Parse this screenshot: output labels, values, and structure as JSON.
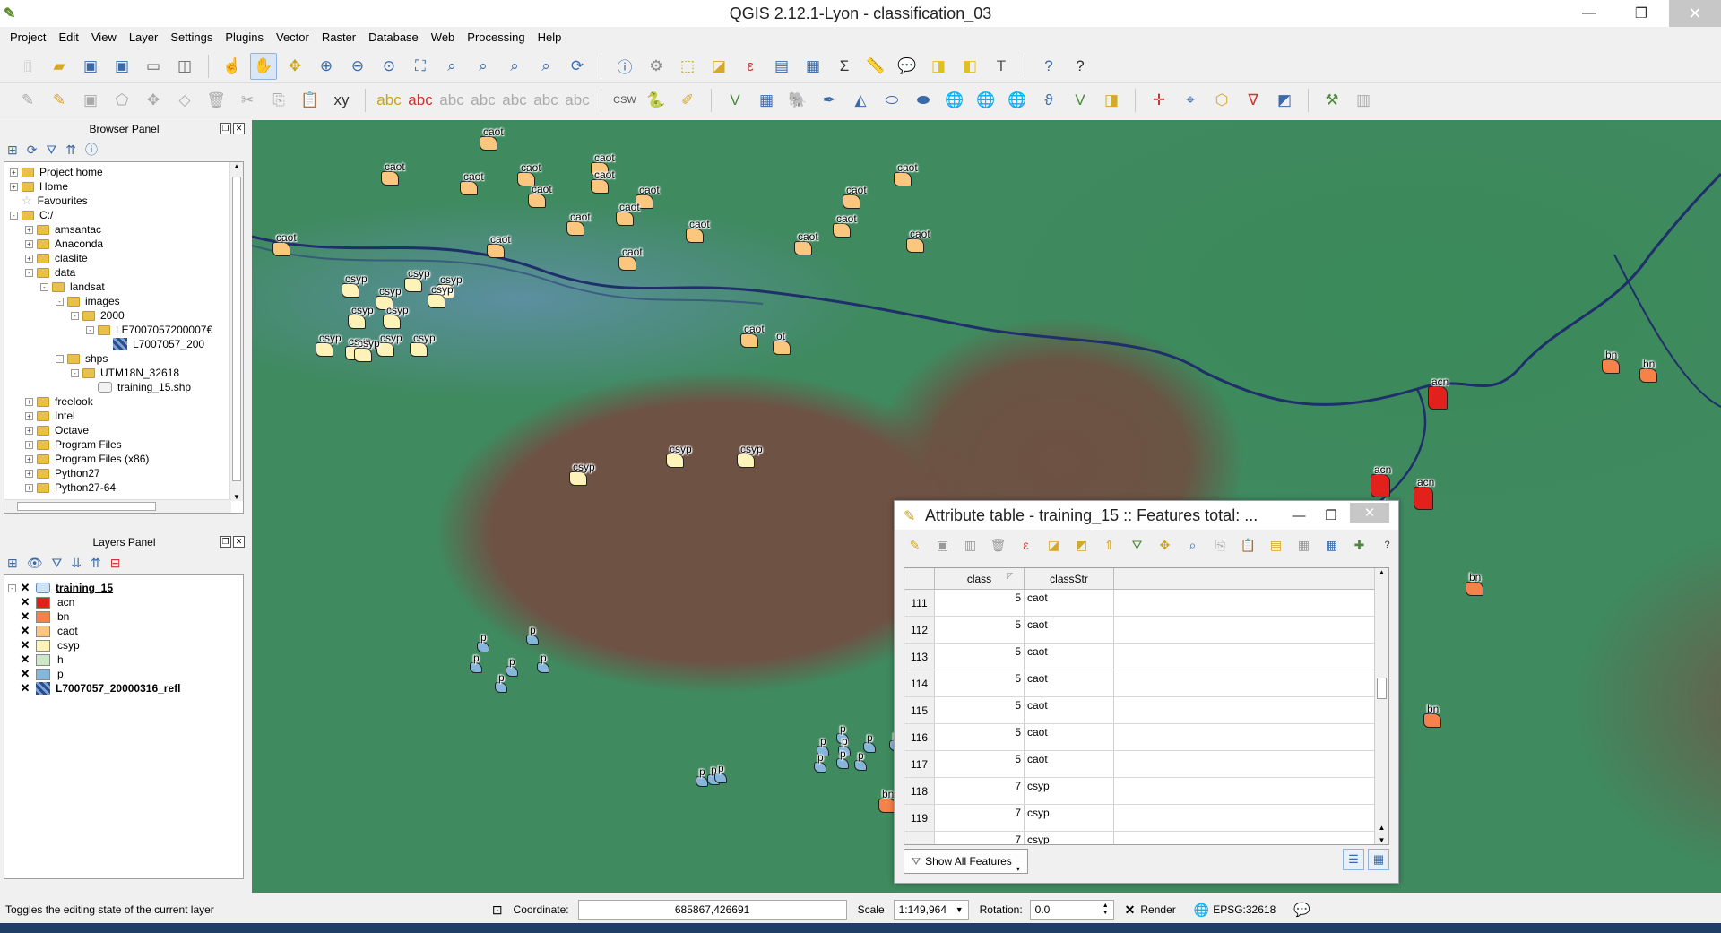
{
  "window": {
    "title": "QGIS 2.12.1-Lyon - classification_03"
  },
  "menu": [
    "Project",
    "Edit",
    "View",
    "Layer",
    "Settings",
    "Plugins",
    "Vector",
    "Raster",
    "Database",
    "Web",
    "Processing",
    "Help"
  ],
  "browser_panel": {
    "title": "Browser Panel",
    "items": [
      {
        "label": "Project home",
        "indent": 0,
        "exp": "+",
        "icon": "folder"
      },
      {
        "label": "Home",
        "indent": 0,
        "exp": "+",
        "icon": "folder"
      },
      {
        "label": "Favourites",
        "indent": 0,
        "exp": "",
        "icon": "star"
      },
      {
        "label": "C:/",
        "indent": 0,
        "exp": "-",
        "icon": "folder"
      },
      {
        "label": "amsantac",
        "indent": 1,
        "exp": "+",
        "icon": "folder"
      },
      {
        "label": "Anaconda",
        "indent": 1,
        "exp": "+",
        "icon": "folder"
      },
      {
        "label": "claslite",
        "indent": 1,
        "exp": "+",
        "icon": "folder"
      },
      {
        "label": "data",
        "indent": 1,
        "exp": "-",
        "icon": "folder"
      },
      {
        "label": "landsat",
        "indent": 2,
        "exp": "-",
        "icon": "folder"
      },
      {
        "label": "images",
        "indent": 3,
        "exp": "-",
        "icon": "folder"
      },
      {
        "label": "2000",
        "indent": 4,
        "exp": "-",
        "icon": "folder"
      },
      {
        "label": "LE7007057200007€",
        "indent": 5,
        "exp": "-",
        "icon": "folder"
      },
      {
        "label": "L7007057_200",
        "indent": 6,
        "exp": "",
        "icon": "raster"
      },
      {
        "label": "shps",
        "indent": 3,
        "exp": "-",
        "icon": "folder"
      },
      {
        "label": "UTM18N_32618",
        "indent": 4,
        "exp": "-",
        "icon": "folder"
      },
      {
        "label": "training_15.shp",
        "indent": 5,
        "exp": "",
        "icon": "vector"
      },
      {
        "label": "freelook",
        "indent": 1,
        "exp": "+",
        "icon": "folder"
      },
      {
        "label": "Intel",
        "indent": 1,
        "exp": "+",
        "icon": "folder"
      },
      {
        "label": "Octave",
        "indent": 1,
        "exp": "+",
        "icon": "folder"
      },
      {
        "label": "Program Files",
        "indent": 1,
        "exp": "+",
        "icon": "folder"
      },
      {
        "label": "Program Files (x86)",
        "indent": 1,
        "exp": "+",
        "icon": "folder"
      },
      {
        "label": "Python27",
        "indent": 1,
        "exp": "+",
        "icon": "folder"
      },
      {
        "label": "Python27-64",
        "indent": 1,
        "exp": "+",
        "icon": "folder"
      }
    ]
  },
  "layers_panel": {
    "title": "Layers Panel",
    "vector_layer": "training_15",
    "classes": [
      {
        "label": "acn",
        "color": "#e2201c"
      },
      {
        "label": "bn",
        "color": "#f6824a"
      },
      {
        "label": "caot",
        "color": "#fbc77e"
      },
      {
        "label": "csyp",
        "color": "#fdf3b8"
      },
      {
        "label": "h",
        "color": "#cce8c8"
      },
      {
        "label": "p",
        "color": "#86b6da"
      }
    ],
    "raster_layer": "L7007057_20000316_refl"
  },
  "attribute_table": {
    "title": "Attribute table - training_15 :: Features total: ...",
    "columns": [
      "class",
      "classStr"
    ],
    "rows": [
      {
        "idx": "111",
        "class": "5",
        "classStr": "caot"
      },
      {
        "idx": "112",
        "class": "5",
        "classStr": "caot"
      },
      {
        "idx": "113",
        "class": "5",
        "classStr": "caot"
      },
      {
        "idx": "114",
        "class": "5",
        "classStr": "caot"
      },
      {
        "idx": "115",
        "class": "5",
        "classStr": "caot"
      },
      {
        "idx": "116",
        "class": "5",
        "classStr": "caot"
      },
      {
        "idx": "117",
        "class": "5",
        "classStr": "caot"
      },
      {
        "idx": "118",
        "class": "7",
        "classStr": "csyp"
      },
      {
        "idx": "119",
        "class": "7",
        "classStr": "csyp"
      },
      {
        "idx": "",
        "class": "7",
        "classStr": "csyp"
      }
    ],
    "show_all": "Show All Features",
    "help": "?"
  },
  "map_labels": [
    {
      "t": "caot",
      "c": "caot"
    },
    {
      "t": "caot",
      "c": "caot"
    },
    {
      "t": "caot",
      "c": "caot"
    },
    {
      "t": "caot",
      "c": "caot"
    },
    {
      "t": "caot",
      "c": "caot"
    },
    {
      "t": "caot",
      "c": "caot"
    },
    {
      "t": "caot",
      "c": "caot"
    },
    {
      "t": "caot",
      "c": "caot"
    },
    {
      "t": "caot",
      "c": "caot"
    },
    {
      "t": "caot",
      "c": "caot"
    },
    {
      "t": "caot",
      "c": "caot"
    },
    {
      "t": "caot",
      "c": "caot"
    },
    {
      "t": "caot",
      "c": "caot"
    },
    {
      "t": "caot",
      "c": "caot"
    },
    {
      "t": "caot",
      "c": "caot"
    },
    {
      "t": "caot",
      "c": "caot"
    },
    {
      "t": "caot",
      "c": "caot"
    },
    {
      "t": "caot",
      "c": "caot"
    },
    {
      "t": "caot",
      "c": "caot"
    },
    {
      "t": "caot",
      "c": "caot"
    },
    {
      "t": "ot",
      "c": "caot"
    },
    {
      "t": "csyp",
      "c": "csyp"
    },
    {
      "t": "csyp",
      "c": "csyp"
    },
    {
      "t": "csyp",
      "c": "csyp"
    },
    {
      "t": "csyp",
      "c": "csyp"
    },
    {
      "t": "csyp",
      "c": "csyp"
    },
    {
      "t": "csyp",
      "c": "csyp"
    },
    {
      "t": "csyp",
      "c": "csyp"
    },
    {
      "t": "csyp",
      "c": "csyp"
    },
    {
      "t": "csyp",
      "c": "csyp"
    },
    {
      "t": "csyp",
      "c": "csyp"
    },
    {
      "t": "csyp",
      "c": "csyp"
    },
    {
      "t": "csyp",
      "c": "csyp"
    },
    {
      "t": "csyp",
      "c": "csyp"
    },
    {
      "t": "csyp",
      "c": "csyp"
    },
    {
      "t": "csyp",
      "c": "csyp"
    },
    {
      "t": "acn",
      "c": "acn"
    },
    {
      "t": "acn",
      "c": "acn"
    },
    {
      "t": "acn",
      "c": "acn"
    },
    {
      "t": "bn",
      "c": "bn"
    },
    {
      "t": "bn",
      "c": "bn"
    },
    {
      "t": "bn",
      "c": "bn"
    },
    {
      "t": "bn",
      "c": "bn"
    },
    {
      "t": "bn",
      "c": "bn"
    },
    {
      "t": "bn",
      "c": "bn"
    },
    {
      "t": "bn",
      "c": "bn"
    },
    {
      "t": "p",
      "c": "p"
    },
    {
      "t": "p",
      "c": "p"
    },
    {
      "t": "p",
      "c": "p"
    },
    {
      "t": "p",
      "c": "p"
    },
    {
      "t": "p",
      "c": "p"
    },
    {
      "t": "p",
      "c": "p"
    },
    {
      "t": "p",
      "c": "p"
    },
    {
      "t": "p",
      "c": "p"
    },
    {
      "t": "p",
      "c": "p"
    },
    {
      "t": "p",
      "c": "p"
    },
    {
      "t": "p",
      "c": "p"
    },
    {
      "t": "p",
      "c": "p"
    },
    {
      "t": "p",
      "c": "p"
    },
    {
      "t": "p",
      "c": "p"
    },
    {
      "t": "p",
      "c": "p"
    },
    {
      "t": "p",
      "c": "p"
    },
    {
      "t": "p",
      "c": "p"
    },
    {
      "t": "p",
      "c": "p"
    }
  ],
  "status": {
    "message": "Toggles the editing state of the current layer",
    "coordinate_label": "Coordinate:",
    "coordinate": "685867,426691",
    "scale_label": "Scale",
    "scale": "1:149,964",
    "rotation_label": "Rotation:",
    "rotation": "0.0",
    "render_label": "Render",
    "crs": "EPSG:32618"
  }
}
